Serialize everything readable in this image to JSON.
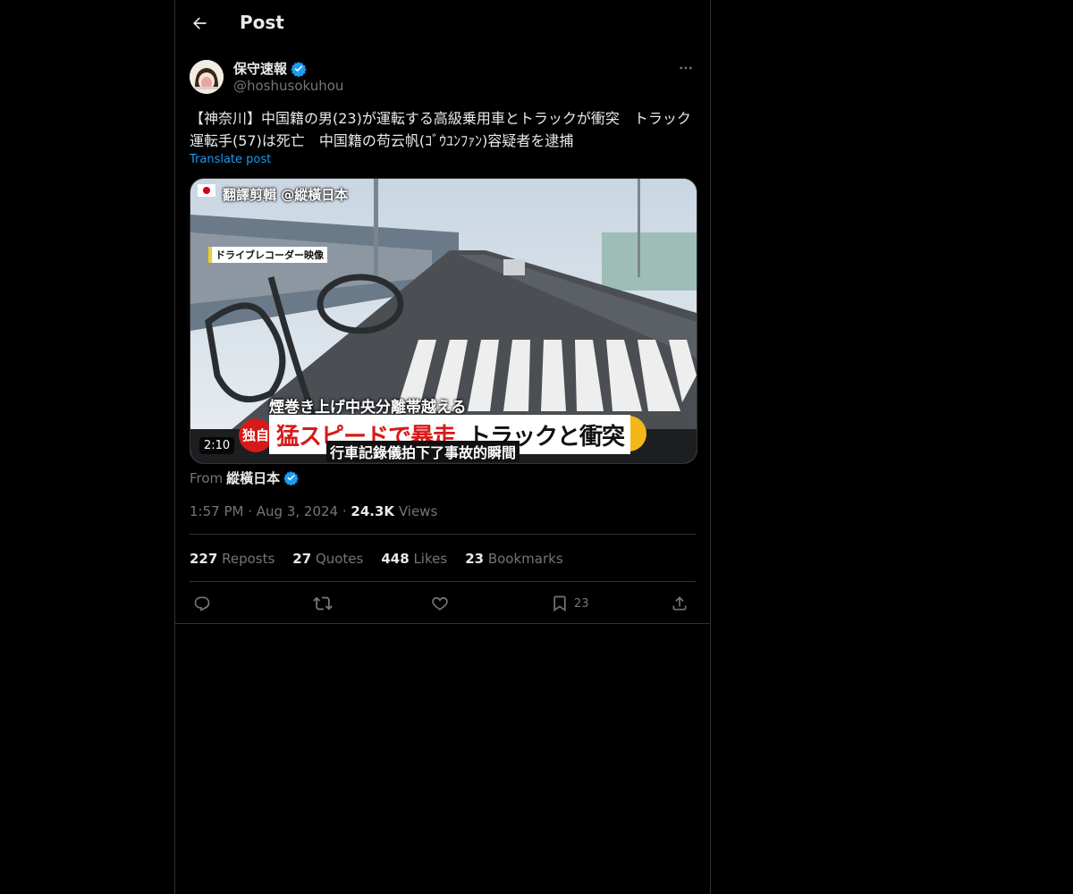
{
  "header": {
    "title": "Post"
  },
  "author": {
    "display_name": "保守速報",
    "handle": "@hoshusokuhou",
    "verified_color": "#1d9bf0"
  },
  "post": {
    "text": "【神奈川】中国籍の男(23)が運転する高級乗用車とトラックが衝突　トラック運転手(57)は死亡　中国籍の苟云帆(ｺﾞｳﾕﾝﾌｧﾝ)容疑者を逮捕",
    "translate_label": "Translate post"
  },
  "media": {
    "watermark": "翻譯剪輯 @縱橫日本",
    "source_label": "ドライブレコーダー映像",
    "caption_top": "煙巻き上げ中央分離帯越える",
    "badge": "独自",
    "headline_red": "猛スピードで暴走",
    "headline_black": "トラックと衝突",
    "subtitle": "行車記錄儀拍下了事故的瞬間",
    "duration": "2:10"
  },
  "from": {
    "label": "From",
    "name": "縱橫日本"
  },
  "meta": {
    "time": "1:57 PM",
    "date": "Aug 3, 2024",
    "views_count": "24.3K",
    "views_label": "Views"
  },
  "stats": {
    "reposts_count": "227",
    "reposts_label": "Reposts",
    "quotes_count": "27",
    "quotes_label": "Quotes",
    "likes_count": "448",
    "likes_label": "Likes",
    "bookmarks_count": "23",
    "bookmarks_label": "Bookmarks"
  },
  "actions": {
    "bookmark_count": "23"
  },
  "icons": [
    "back-arrow-icon",
    "verified-badge-icon",
    "more-icon",
    "reply-icon",
    "repost-icon",
    "like-icon",
    "bookmark-icon",
    "share-icon"
  ]
}
